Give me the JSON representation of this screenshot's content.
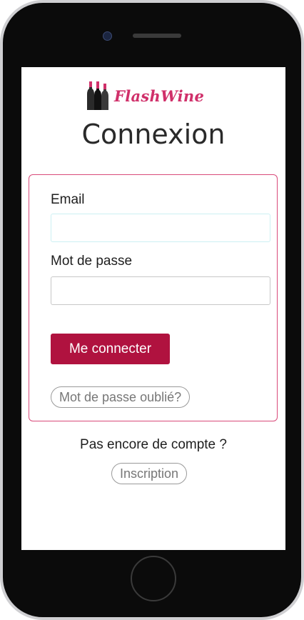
{
  "brand": {
    "name": "FlashWine",
    "logo_icon": "wine-bottles-icon",
    "color": "#d0306a"
  },
  "page": {
    "title": "Connexion"
  },
  "form": {
    "email_label": "Email",
    "email_value": "",
    "password_label": "Mot de passe",
    "password_value": "",
    "submit_label": "Me connecter",
    "forgot_label": "Mot de passe oublié?"
  },
  "signup": {
    "prompt": "Pas encore de compte ?",
    "button_label": "Inscription"
  },
  "colors": {
    "accent": "#b0123f",
    "card_border": "#d94a7a",
    "phone_frame": "#0b0b0b"
  }
}
